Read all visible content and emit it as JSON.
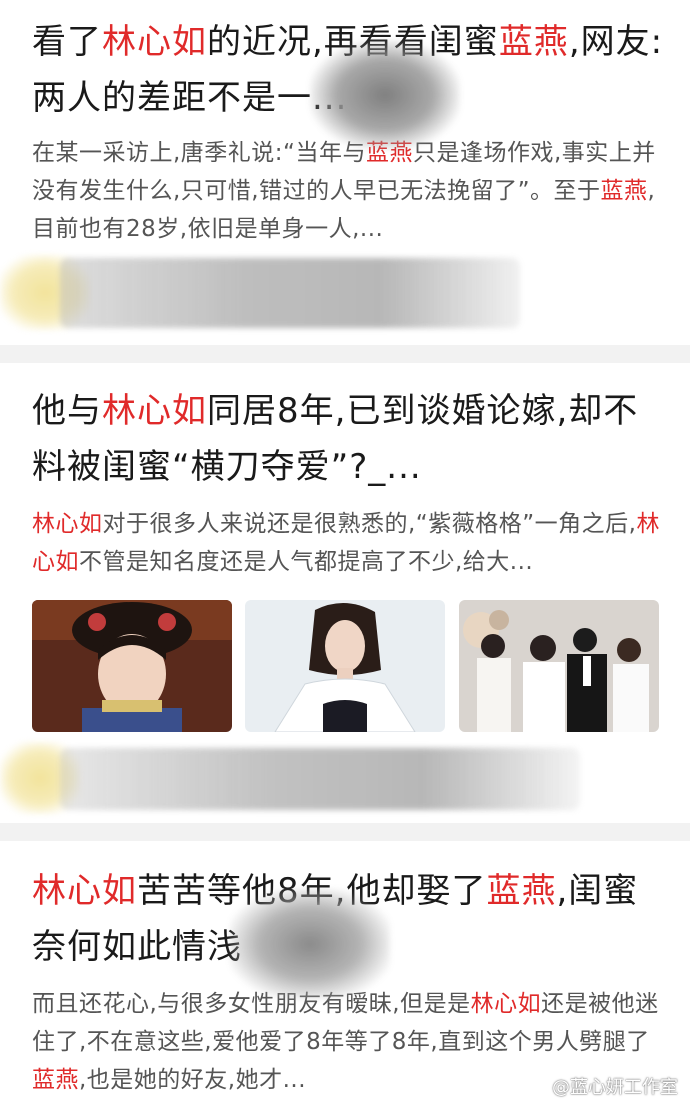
{
  "articles": [
    {
      "title_parts": [
        "看了",
        "林心如",
        "的近况,再看看闺蜜",
        "蓝燕",
        ",网友:",
        "两人的差距不是一..."
      ],
      "snippet_parts": [
        "在某一采访上,唐季礼说:“当年与",
        "蓝燕",
        "只是逢场作戏,事实上并没有发生什么,只可惜,错过的人早已无法挽留了”。至于",
        "蓝燕",
        ",目前也有28岁,依旧是单身一人,..."
      ]
    },
    {
      "title_parts": [
        "他与",
        "林心如",
        "同居8年,已到谈婚论嫁,却不料被闺蜜“横刀夺爱”?_..."
      ],
      "snippet_parts": [
        "林心如",
        "对于很多人来说还是很熟悉的,“紫薇格格”一角之后,",
        "林心如",
        "不管是知名度还是人气都提高了不少,给大..."
      ]
    },
    {
      "title_parts": [
        "林心如",
        "苦苦等他8年,他却娶了",
        "蓝燕",
        ",闺蜜奈何如此情浅"
      ],
      "snippet_parts": [
        "而且还花心,与很多女性朋友有暧昧,但是是",
        "林心如",
        "还是被他迷住了,不在意这些,爱他爱了8年等了8年,直到这个男人劈腿了",
        "蓝燕",
        ",也是她的好友,她才..."
      ]
    }
  ],
  "watermark": "@蓝心妍工作室",
  "colors": {
    "highlight": "#e02a2a",
    "title": "#1a1a1a",
    "snippet": "#555555",
    "divider": "#f2f2f2"
  }
}
